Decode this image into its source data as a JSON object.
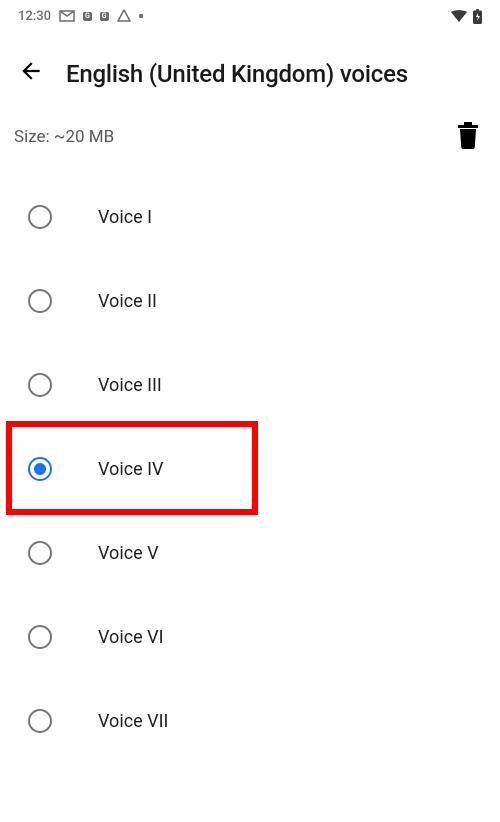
{
  "status_bar": {
    "time": "12:30",
    "icons_left": [
      "gmail",
      "badge1",
      "badge2",
      "drive",
      "dot"
    ]
  },
  "header": {
    "title": "English (United Kingdom) voices"
  },
  "size_row": {
    "label": "Size: ~20 MB"
  },
  "voices": [
    {
      "label": "Voice I",
      "selected": false,
      "highlighted": false
    },
    {
      "label": "Voice II",
      "selected": false,
      "highlighted": false
    },
    {
      "label": "Voice III",
      "selected": false,
      "highlighted": false
    },
    {
      "label": "Voice IV",
      "selected": true,
      "highlighted": true
    },
    {
      "label": "Voice V",
      "selected": false,
      "highlighted": false
    },
    {
      "label": "Voice VI",
      "selected": false,
      "highlighted": false
    },
    {
      "label": "Voice VII",
      "selected": false,
      "highlighted": false
    }
  ],
  "colors": {
    "accent": "#1a73e8",
    "highlight": "#ff0000"
  }
}
